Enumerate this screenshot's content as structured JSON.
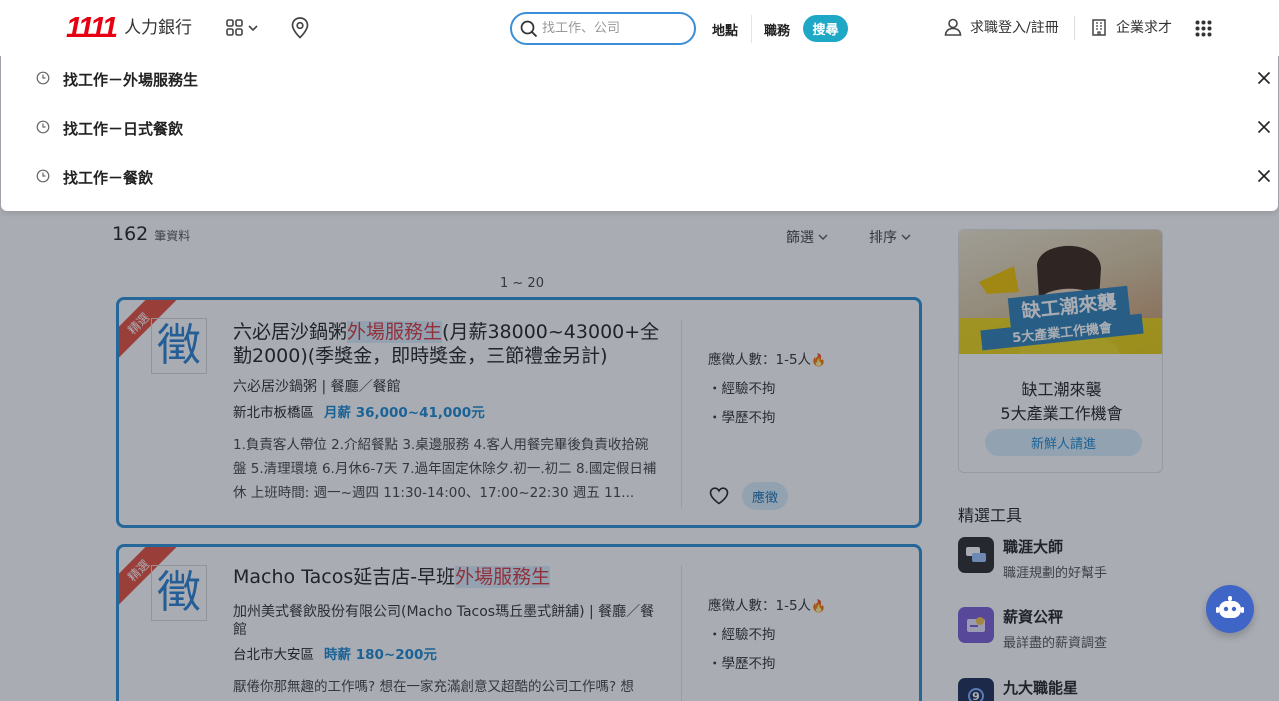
{
  "header": {
    "logo_number": "1111",
    "logo_text": "人力銀行",
    "search_placeholder": "找工作、公司",
    "location_label": "地點",
    "job_label": "職務",
    "search_button": "搜尋",
    "login_label": "求職登入/註冊",
    "employer_label": "企業求才"
  },
  "dropdown": {
    "items": [
      {
        "label": "找工作－外場服務生"
      },
      {
        "label": "找工作－日式餐飲"
      },
      {
        "label": "找工作－餐飲"
      }
    ]
  },
  "results": {
    "count": "162",
    "count_unit": "筆資料",
    "filter_label": "篩選",
    "sort_label": "排序",
    "pager": "1 ~ 20"
  },
  "jobs": [
    {
      "badge": "精選",
      "logo_char": "徵",
      "title_before": "六必居沙鍋粥",
      "title_highlight": "外場服務生",
      "title_after": "(月薪38000~43000+全勤2000)(季獎金，即時獎金，三節禮金另計)",
      "company": "六必居沙鍋粥 | 餐廳／餐館",
      "location": "新北市板橋區",
      "salary": "月薪 36,000~41,000元",
      "description": "1.負責客人帶位 2.介紹餐點 3.桌邊服務 4.客人用餐完畢後負責收拾碗盤 5.清理環境 6.月休6-7天 7.過年固定休除夕.初一.初二 8.國定假日補休 上班時間: 週一~週四 11:30-14:00、17:00~22:30 週五 11...",
      "headcount": "應徵人數：1-5人",
      "experience": "・經驗不拘",
      "education": "・學歷不拘",
      "apply_label": "應徵"
    },
    {
      "badge": "精選",
      "logo_char": "徵",
      "title_before": "Macho Tacos延吉店-早班",
      "title_highlight": "外場服務生",
      "title_after": "",
      "company": "加州美式餐飲股份有限公司(Macho Tacos瑪丘墨式餅舖) | 餐廳／餐館",
      "location": "台北市大安區",
      "salary": "時薪 180~200元",
      "description": "厭倦你那無趣的工作嗎? 想在一家充滿創意又超酷的公司工作嗎? 想",
      "headcount": "應徵人數：1-5人",
      "experience": "・經驗不拘",
      "education": "・學歷不拘"
    }
  ],
  "sidebar": {
    "banner_image_text_1": "缺工潮來襲",
    "banner_image_text_2": "5大產業工作機會",
    "banner_title_1": "缺工潮來襲",
    "banner_title_2": "5大產業工作機會",
    "banner_button": "新鮮人請進",
    "tools_heading": "精選工具",
    "tools": [
      {
        "name": "職涯大師",
        "desc": "職涯規劃的好幫手",
        "color": "#2b2b2b"
      },
      {
        "name": "薪資公秤",
        "desc": "最詳盡的薪資調查",
        "color": "#7b5cd6"
      },
      {
        "name": "九大職能星",
        "desc": "",
        "color": "#1e2a55"
      }
    ]
  },
  "colors": {
    "brand_red": "#e60012",
    "accent_blue": "#2b8fd6",
    "search_button": "#1ea8c5",
    "highlight_red": "#d9363e"
  }
}
